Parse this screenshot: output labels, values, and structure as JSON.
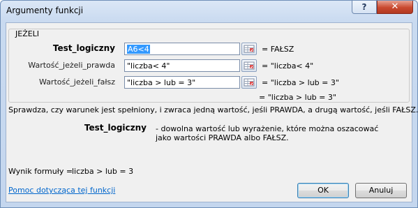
{
  "window": {
    "title": "Argumenty funkcji",
    "help_glyph": "?",
    "close_glyph": "✕"
  },
  "function_group": {
    "name": "JEŻELI",
    "args": [
      {
        "label": "Test_logiczny",
        "value_highlight": "A6<4",
        "value": "",
        "result": "=   FAŁSZ"
      },
      {
        "label": "Wartość_jeżeli_prawda",
        "value_highlight": "",
        "value": "\"liczba< 4\"",
        "result": "=   \"liczba< 4\""
      },
      {
        "label": "Wartość_jeżeli_fałsz",
        "value_highlight": "",
        "value": "\"liczba > lub = 3\"",
        "result": "=   \"liczba > lub = 3\""
      }
    ],
    "formula_result": "=   \"liczba > lub = 3\""
  },
  "description": "Sprawdza, czy warunek jest spełniony, i zwraca jedną wartość, jeśli PRAWDA, a drugą wartość, jeśli FAŁSZ.",
  "arg_description": {
    "name": "Test_logiczny",
    "text": "- dowolna wartość lub wyrażenie, które można oszacować jako wartości PRAWDA albo FAŁSZ."
  },
  "result": {
    "label": "Wynik formuły =",
    "value": "liczba > lub = 3"
  },
  "help_link": "Pomoc dotycząca tej funkcji",
  "buttons": {
    "ok": "OK",
    "cancel": "Anuluj"
  },
  "colors": {
    "titlebar": "#c9daf0",
    "close": "#c9492f",
    "link": "#0066cc",
    "selection": "#3399ff"
  }
}
